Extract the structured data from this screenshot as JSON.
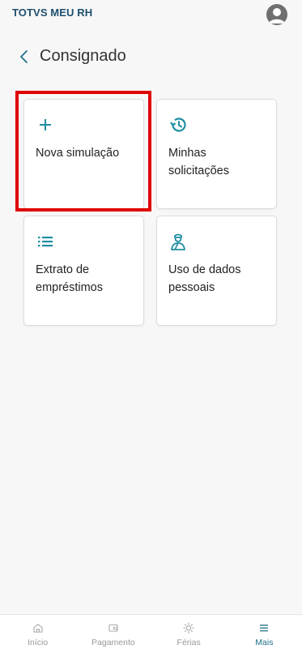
{
  "header": {
    "app_title": "TOTVS MEU RH"
  },
  "page": {
    "title": "Consignado"
  },
  "cards": [
    {
      "label": "Nova simulação",
      "icon": "plus-icon"
    },
    {
      "label": "Minhas solicitações",
      "icon": "history-icon"
    },
    {
      "label": "Extrato de empréstimos",
      "icon": "list-icon"
    },
    {
      "label": "Uso de dados pessoais",
      "icon": "person-icon"
    }
  ],
  "bottom_nav": [
    {
      "label": "Início",
      "icon": "home-icon",
      "active": false
    },
    {
      "label": "Pagamento",
      "icon": "wallet-icon",
      "active": false
    },
    {
      "label": "Férias",
      "icon": "sun-icon",
      "active": false
    },
    {
      "label": "Mais",
      "icon": "menu-icon",
      "active": true
    }
  ],
  "colors": {
    "accent": "#1f8ea1",
    "title": "#1d4f6b",
    "highlight": "#e00000"
  }
}
